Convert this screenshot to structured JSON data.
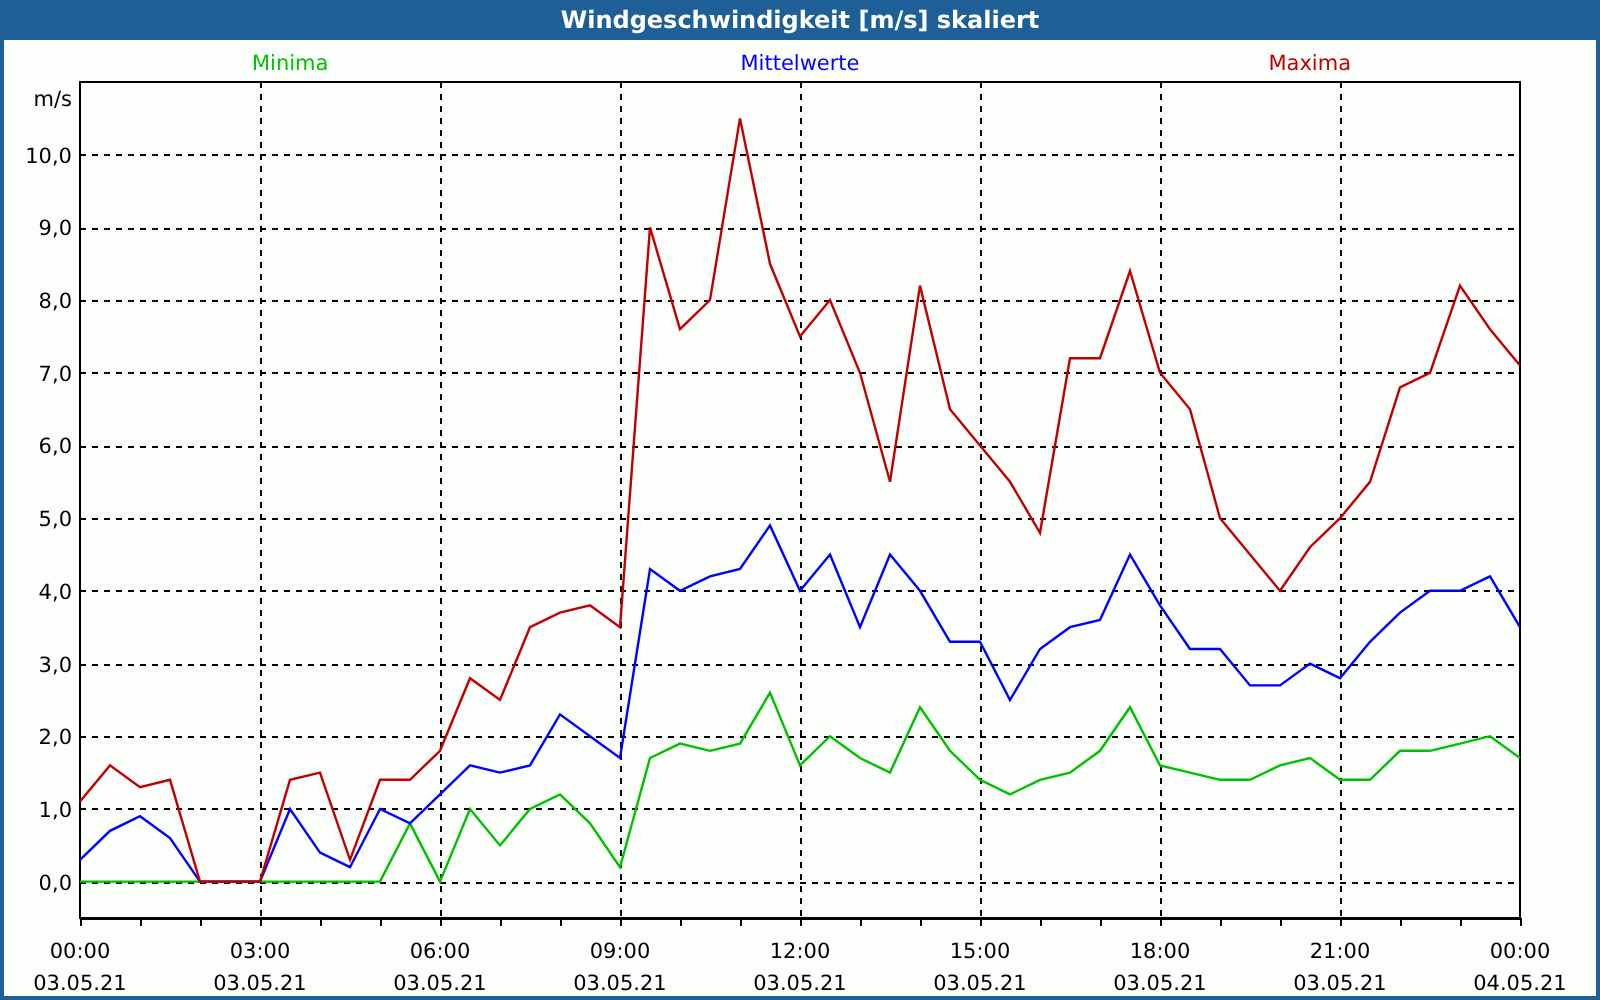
{
  "window": {
    "title": "Windgeschwindigkeit [m/s] skaliert"
  },
  "chart": {
    "chart_data": {
      "type": "line",
      "ylabel": "m/s",
      "categories": [
        "00:00\n03.05.21",
        null,
        null,
        null,
        null,
        null,
        "03:00\n03.05.21",
        null,
        null,
        null,
        null,
        null,
        "06:00\n03.05.21",
        null,
        null,
        null,
        null,
        null,
        "09:00\n03.05.21",
        null,
        null,
        null,
        null,
        null,
        "12:00\n03.05.21",
        null,
        null,
        null,
        null,
        null,
        "15:00\n03.05.21",
        null,
        null,
        null,
        null,
        null,
        "18:00\n03.05.21",
        null,
        null,
        null,
        null,
        null,
        "21:00\n03.05.21",
        null,
        null,
        null,
        null,
        null,
        "00:00\n04.05.21"
      ],
      "series": [
        {
          "name": "Minima",
          "color": "#00c000",
          "values": [
            0,
            0,
            0,
            0,
            0,
            0,
            0,
            0,
            0,
            0,
            0,
            0.8,
            0,
            1.0,
            0.5,
            1.0,
            1.2,
            0.8,
            0.2,
            1.7,
            1.9,
            1.8,
            1.9,
            2.6,
            1.6,
            2.0,
            1.7,
            1.5,
            2.4,
            1.8,
            1.4,
            1.2,
            1.4,
            1.5,
            1.8,
            2.4,
            1.6,
            1.5,
            1.4,
            1.4,
            1.6,
            1.7,
            1.4,
            1.4,
            1.8,
            1.8,
            1.9,
            2.0,
            1.7
          ]
        },
        {
          "name": "Mittelwerte",
          "color": "#0000ff",
          "values": [
            0.3,
            0.7,
            0.9,
            0.6,
            0,
            0,
            0,
            1.0,
            0.4,
            0.2,
            1.0,
            0.8,
            1.2,
            1.6,
            1.5,
            1.6,
            2.3,
            2.0,
            1.7,
            4.3,
            4.0,
            4.2,
            4.3,
            4.9,
            4.0,
            4.5,
            3.5,
            4.5,
            4.0,
            3.3,
            3.3,
            2.5,
            3.2,
            3.5,
            3.6,
            4.5,
            3.8,
            3.2,
            3.2,
            2.7,
            2.7,
            3.0,
            2.8,
            3.3,
            3.7,
            4.0,
            4.0,
            4.2,
            3.5
          ]
        },
        {
          "name": "Maxima",
          "color": "#c00000",
          "values": [
            1.1,
            1.6,
            1.3,
            1.4,
            0,
            0,
            0,
            1.4,
            1.5,
            0.3,
            1.4,
            1.4,
            1.8,
            2.8,
            2.5,
            3.5,
            3.7,
            3.8,
            3.5,
            9.0,
            7.6,
            8.0,
            10.5,
            8.5,
            7.5,
            8.0,
            7.0,
            5.5,
            8.2,
            6.5,
            6.0,
            5.5,
            4.8,
            7.2,
            7.2,
            8.4,
            7.0,
            6.5,
            5.0,
            4.5,
            4.0,
            4.6,
            5.0,
            5.5,
            6.8,
            7.0,
            8.2,
            7.6,
            7.1
          ]
        }
      ],
      "ylim": [
        -0.5,
        11
      ],
      "grid": true,
      "yticks": [
        {
          "value": 0,
          "label": "0,0"
        },
        {
          "value": 1,
          "label": "1,0"
        },
        {
          "value": 2,
          "label": "2,0"
        },
        {
          "value": 3,
          "label": "3,0"
        },
        {
          "value": 4,
          "label": "4,0"
        },
        {
          "value": 5,
          "label": "5,0"
        },
        {
          "value": 6,
          "label": "6,0"
        },
        {
          "value": 7,
          "label": "7,0"
        },
        {
          "value": 8,
          "label": "8,0"
        },
        {
          "value": 9,
          "label": "9,0"
        },
        {
          "value": 10,
          "label": "10,0"
        }
      ]
    }
  }
}
